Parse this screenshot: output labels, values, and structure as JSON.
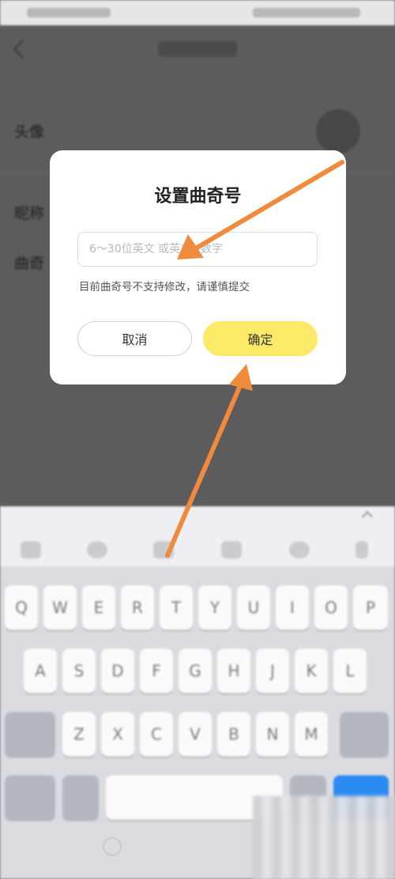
{
  "dialog": {
    "title": "设置曲奇号",
    "input_value": "",
    "input_placeholder": "6～30位英文 或英文+数字",
    "hint": "目前曲奇号不支持修改，请谨慎提交",
    "cancel_label": "取消",
    "confirm_label": "确定"
  },
  "background": {
    "avatar_label": "头像",
    "nickname_label": "昵称",
    "qid_label": "曲奇"
  },
  "keyboard": {
    "row1": [
      "Q",
      "W",
      "E",
      "R",
      "T",
      "Y",
      "U",
      "I",
      "O",
      "P"
    ],
    "row2": [
      "A",
      "S",
      "D",
      "F",
      "G",
      "H",
      "J",
      "K",
      "L"
    ],
    "row3": [
      "Z",
      "X",
      "C",
      "V",
      "B",
      "N",
      "M"
    ]
  },
  "colors": {
    "confirm_button": "#fde968",
    "arrow": "#f08a3c",
    "overlay": "#5c5c5c"
  },
  "icons": {
    "back": "back-arrow-icon",
    "shift": "shift-icon",
    "delete": "backspace-icon"
  }
}
